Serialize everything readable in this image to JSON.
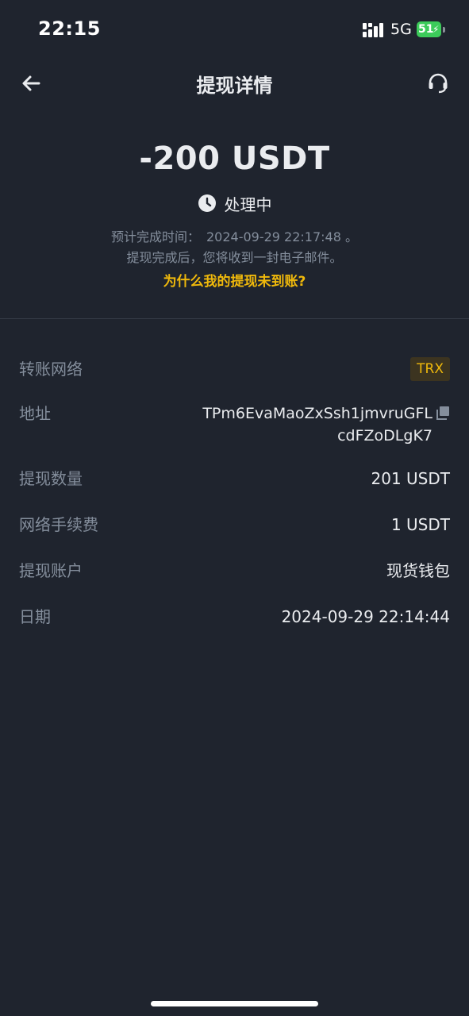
{
  "status_bar": {
    "time": "22:15",
    "network": "5G",
    "battery": "51",
    "battery_color": "#3ccb5a"
  },
  "header": {
    "title": "提现详情",
    "back_icon": "arrow-left-icon",
    "support_icon": "headset-icon"
  },
  "summary": {
    "amount": "-200 USDT",
    "status": "处理中",
    "eta_label": "预计完成时间：",
    "eta_time": "2024-09-29 22:17:48 。",
    "email_note": "提现完成后，您将收到一封电子邮件。",
    "why_link": "为什么我的提现未到账?"
  },
  "details": {
    "network_label": "转账网络",
    "network_value": "TRX",
    "address_label": "地址",
    "address_value": "TPm6EvaMaoZxSsh1jmvruGFLcdFZoDLgK7",
    "amount_label": "提现数量",
    "amount_value": "201 USDT",
    "fee_label": "网络手续费",
    "fee_value": "1 USDT",
    "account_label": "提现账户",
    "account_value": "现货钱包",
    "date_label": "日期",
    "date_value": "2024-09-29 22:14:44"
  },
  "colors": {
    "background": "#1f242e",
    "accent": "#f0b90b",
    "muted": "#848e9c",
    "text": "#eaecef"
  }
}
